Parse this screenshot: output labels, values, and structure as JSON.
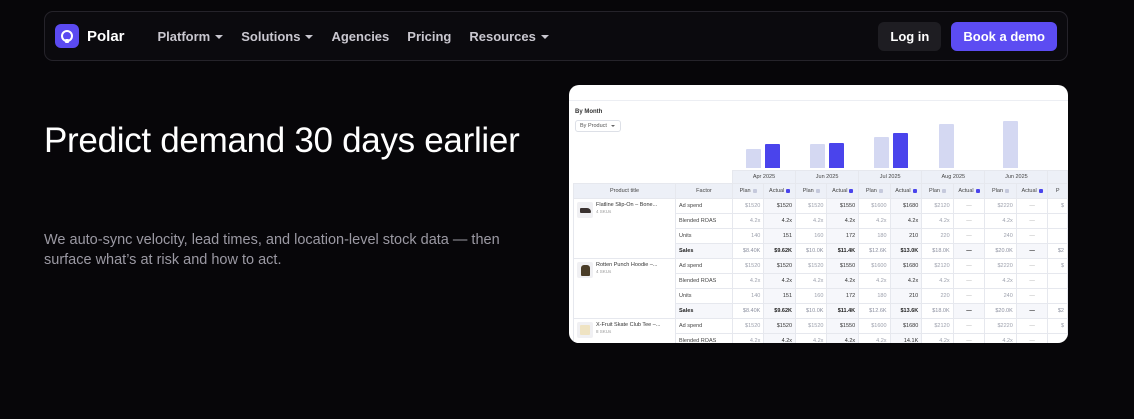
{
  "nav": {
    "brand": "Polar",
    "links": [
      {
        "label": "Platform",
        "dropdown": true
      },
      {
        "label": "Solutions",
        "dropdown": true
      },
      {
        "label": "Agencies",
        "dropdown": false
      },
      {
        "label": "Pricing",
        "dropdown": false
      },
      {
        "label": "Resources",
        "dropdown": true
      }
    ],
    "login_label": "Log in",
    "demo_label": "Book a demo"
  },
  "hero": {
    "title": "Predict demand 30 days earlier",
    "subtitle": "We auto-sync velocity, lead times, and location-level stock data — then surface what’s at risk and how to act."
  },
  "panel": {
    "by_month": "By Month",
    "by_product": "By Product",
    "months": [
      "Apr 2025",
      "Jun 2025",
      "Jul 2025",
      "Aug 2025",
      "Jun 2025"
    ],
    "col_product": "Product title",
    "col_factor": "Factor",
    "col_plan": "Plan",
    "col_actual": "Actual",
    "col_p": "P",
    "products": [
      {
        "name": "Flatline Slip-On – Bone...",
        "sku": "4 SKUs",
        "thumb": "shoe",
        "rows": [
          {
            "factor": "Ad spend",
            "cells": [
              "$1520",
              "$1520",
              "$1520",
              "$1550",
              "$1600",
              "$1680",
              "$2120",
              "—",
              "$2220",
              "—",
              "$"
            ]
          },
          {
            "factor": "Blended ROAS",
            "cells": [
              "4.2x",
              "4.2x",
              "4.2x",
              "4.2x",
              "4.2x",
              "4.2x",
              "4.2x",
              "—",
              "4.2x",
              "—",
              ""
            ]
          },
          {
            "factor": "Units",
            "cells": [
              "140",
              "151",
              "160",
              "172",
              "180",
              "210",
              "220",
              "—",
              "240",
              "—",
              ""
            ]
          },
          {
            "factor": "Sales",
            "cells": [
              "$8.40K",
              "$9.62K",
              "$10.0K",
              "$11.4K",
              "$12.6K",
              "$13.0K",
              "$18.0K",
              "—",
              "$20.0K",
              "—",
              "$2"
            ]
          }
        ]
      },
      {
        "name": "Rotten Punch Hoodie –...",
        "sku": "4 SKUs",
        "thumb": "hoodie",
        "rows": [
          {
            "factor": "Ad spend",
            "cells": [
              "$1520",
              "$1520",
              "$1520",
              "$1550",
              "$1600",
              "$1680",
              "$2120",
              "—",
              "$2220",
              "—",
              "$"
            ]
          },
          {
            "factor": "Blended ROAS",
            "cells": [
              "4.2x",
              "4.2x",
              "4.2x",
              "4.2x",
              "4.2x",
              "4.2x",
              "4.2x",
              "—",
              "4.2x",
              "—",
              ""
            ]
          },
          {
            "factor": "Units",
            "cells": [
              "140",
              "151",
              "160",
              "172",
              "180",
              "210",
              "220",
              "—",
              "240",
              "—",
              ""
            ]
          },
          {
            "factor": "Sales",
            "cells": [
              "$8.40K",
              "$9.62K",
              "$10.0K",
              "$11.4K",
              "$12.6K",
              "$13.6K",
              "$18.0K",
              "—",
              "$20.0K",
              "—",
              "$2"
            ]
          }
        ]
      },
      {
        "name": "X-Fruit Skate Club Tee –...",
        "sku": "8 SKUs",
        "thumb": "tee",
        "rows": [
          {
            "factor": "Ad spend",
            "cells": [
              "$1520",
              "$1520",
              "$1520",
              "$1550",
              "$1600",
              "$1680",
              "$2120",
              "—",
              "$2220",
              "—",
              "$"
            ]
          },
          {
            "factor": "Blended ROAS",
            "cells": [
              "4.2x",
              "4.2x",
              "4.2x",
              "4.2x",
              "4.2x",
              "14.1K",
              "4.2x",
              "—",
              "4.2x",
              "—",
              ""
            ]
          }
        ]
      }
    ],
    "bars": [
      {
        "plan": 0.19,
        "actual": 0.24
      },
      {
        "plan": 0.24,
        "actual": 0.25
      },
      {
        "plan": 0.31,
        "actual": 0.35
      },
      {
        "plan": 0.44,
        "actual": 0
      },
      {
        "plan": 0.47,
        "actual": 0
      }
    ]
  }
}
